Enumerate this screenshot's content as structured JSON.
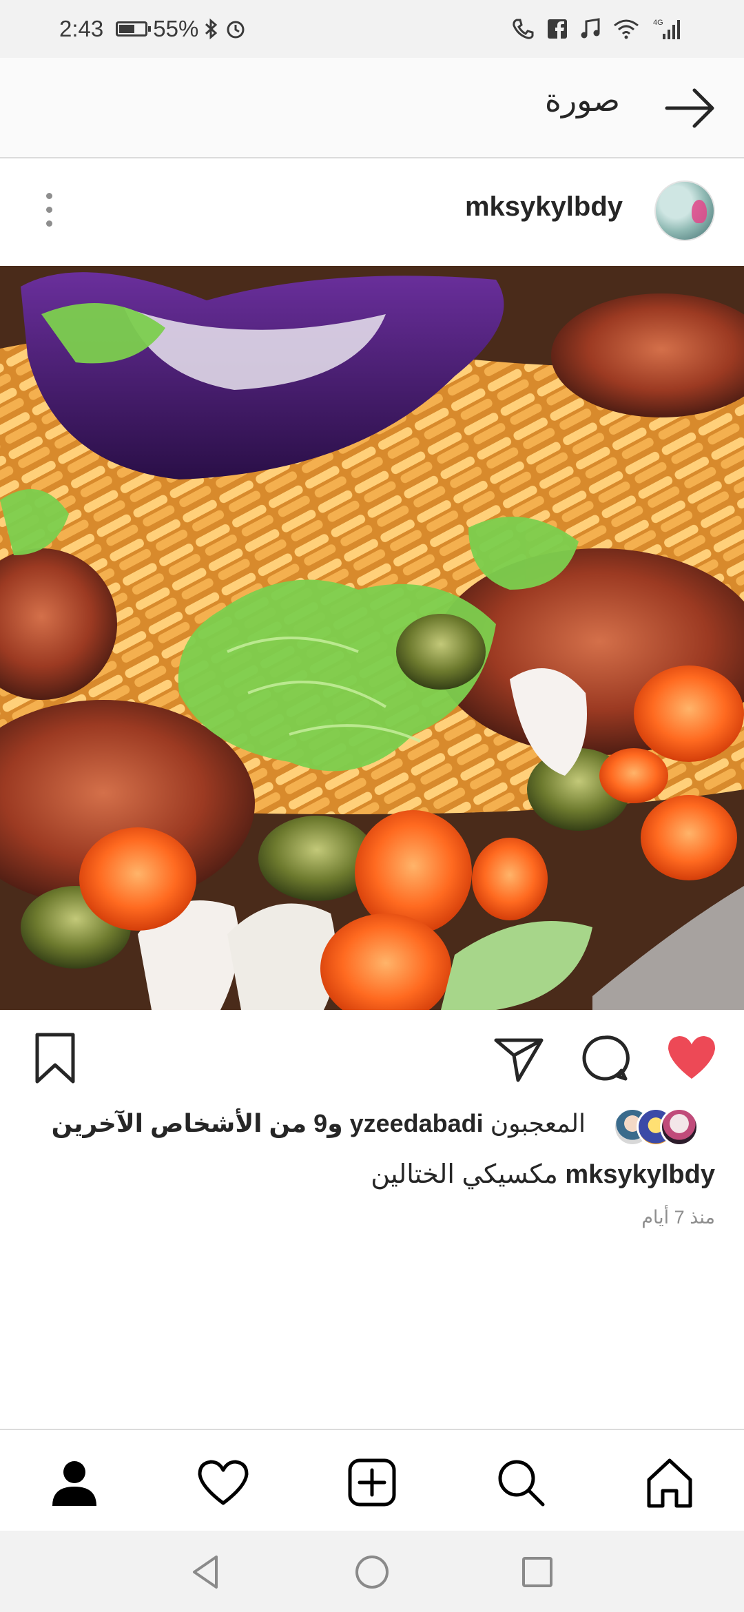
{
  "status_bar": {
    "time": "2:43",
    "battery": "55%"
  },
  "header": {
    "title": "صورة"
  },
  "post": {
    "username": "mksykylbdy",
    "likes": {
      "prefix": "المعجبون",
      "user": "yzeedabadi",
      "suffix": "و9 من الأشخاص الآخرين"
    },
    "caption": {
      "username": "mksykylbdy",
      "text": "مكسيكي الختالين"
    },
    "timestamp": "منذ 7 أيام"
  },
  "icons": {
    "back": "arrow-right-icon",
    "more": "more-vertical-icon",
    "like": "heart-filled-icon",
    "comment": "comment-icon",
    "share": "send-icon",
    "save": "bookmark-icon",
    "nav": [
      "profile-icon",
      "heart-icon",
      "plus-square-icon",
      "search-icon",
      "home-icon"
    ]
  },
  "colors": {
    "like_red": "#ed4956",
    "text": "#262626",
    "muted": "#8e8e8e"
  }
}
